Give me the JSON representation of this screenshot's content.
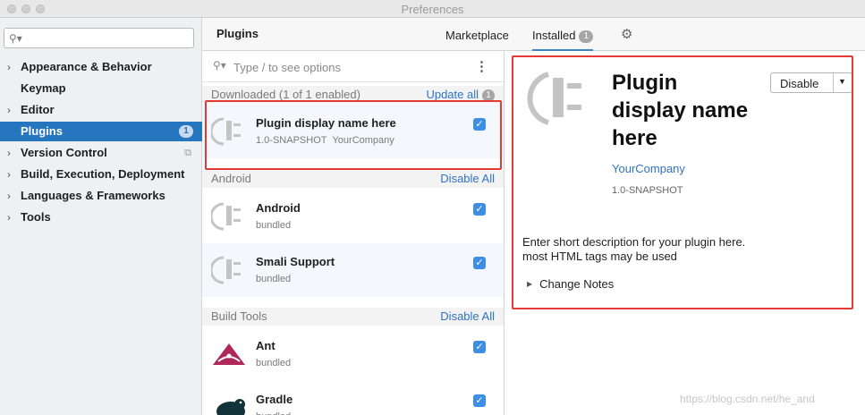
{
  "window": {
    "title": "Preferences"
  },
  "sidebar": {
    "search_placeholder": "",
    "items": [
      {
        "label": "Appearance & Behavior",
        "expandable": true
      },
      {
        "label": "Keymap",
        "expandable": false
      },
      {
        "label": "Editor",
        "expandable": true
      },
      {
        "label": "Plugins",
        "expandable": false,
        "selected": true,
        "badge": "1"
      },
      {
        "label": "Version Control",
        "expandable": true
      },
      {
        "label": "Build, Execution, Deployment",
        "expandable": true
      },
      {
        "label": "Languages & Frameworks",
        "expandable": true
      },
      {
        "label": "Tools",
        "expandable": true
      }
    ]
  },
  "header": {
    "title": "Plugins",
    "tabs": [
      {
        "label": "Marketplace",
        "active": false
      },
      {
        "label": "Installed",
        "active": true,
        "badge": "1"
      }
    ]
  },
  "plugin_list": {
    "search_placeholder": "Type / to see options",
    "groups": [
      {
        "label": "Downloaded (1 of 1 enabled)",
        "action": "Update all",
        "action_badge": "1",
        "plugins": [
          {
            "name": "Plugin display name here",
            "version": "1.0-SNAPSHOT",
            "vendor": "YourCompany",
            "enabled": true,
            "icon": "plugin-plug-icon"
          }
        ]
      },
      {
        "label": "Android",
        "action": "Disable All",
        "plugins": [
          {
            "name": "Android",
            "version": "bundled",
            "enabled": true,
            "icon": "plugin-plug-icon"
          },
          {
            "name": "Smali Support",
            "version": "bundled",
            "enabled": true,
            "icon": "plugin-plug-icon"
          }
        ]
      },
      {
        "label": "Build Tools",
        "action": "Disable All",
        "plugins": [
          {
            "name": "Ant",
            "version": "bundled",
            "enabled": true,
            "icon": "ant-logo-icon"
          },
          {
            "name": "Gradle",
            "version": "bundled",
            "enabled": true,
            "icon": "gradle-elephant-icon"
          }
        ]
      }
    ]
  },
  "detail": {
    "name": "Plugin display name here",
    "vendor": "YourCompany",
    "version": "1.0-SNAPSHOT",
    "description_lines": [
      "Enter short description for your plugin here.",
      "most HTML tags may be used"
    ],
    "change_notes_label": "Change Notes",
    "disable_button_label": "Disable"
  },
  "watermark": "https://blog.csdn.net/he_and",
  "colors": {
    "accent": "#2675bf",
    "link": "#2f73c6",
    "checkbox": "#3d8ee6",
    "highlight_box": "#e53935"
  }
}
